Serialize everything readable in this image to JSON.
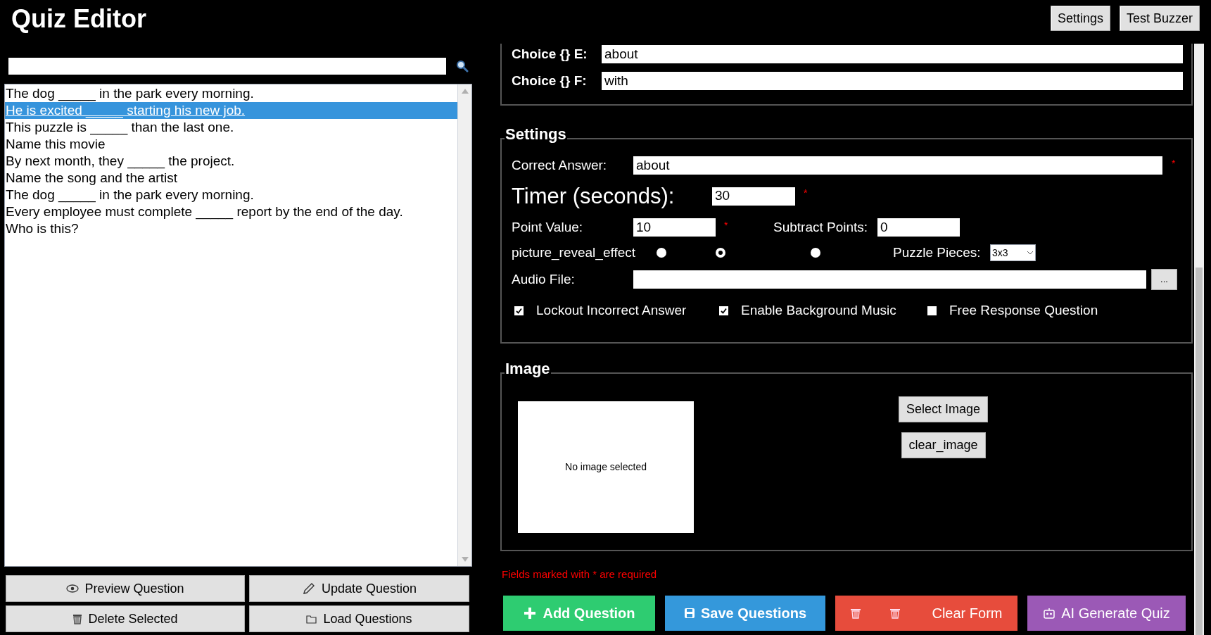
{
  "window": {
    "title": "Quiz Editor"
  },
  "header_buttons": [
    "Settings",
    "Test Buzzer"
  ],
  "questions": [
    {
      "text": "The dog _____ in the park every morning.",
      "selected": false
    },
    {
      "text": "He is excited _____ starting his new job.",
      "selected": true
    },
    {
      "text": "This puzzle is _____ than the last one.",
      "selected": false
    },
    {
      "text": "Name this movie",
      "selected": false
    },
    {
      "text": "By next month, they _____ the project.",
      "selected": false
    },
    {
      "text": "Name the song and the artist",
      "selected": false
    },
    {
      "text": "The dog _____ in the park every morning.",
      "selected": false
    },
    {
      "text": "Every employee must complete _____ report by the end of the day.",
      "selected": false
    },
    {
      "text": "Who is this?",
      "selected": false
    }
  ],
  "list_buttons": [
    "Preview Question",
    "Update Question",
    "Delete Selected",
    "Load Questions"
  ],
  "choices": [
    {
      "label": "Choice {} E:",
      "value": "about"
    },
    {
      "label": "Choice {} F:",
      "value": "with"
    }
  ],
  "settings": {
    "title": "Settings",
    "correct_answer": {
      "label": "Correct Answer:",
      "value": "about",
      "required_mark": "*"
    },
    "timer": {
      "label": "Timer (seconds):",
      "value": "30",
      "required_mark": "*"
    },
    "point_value": {
      "label": "Point Value:",
      "value": "10",
      "required_mark": "*"
    },
    "subtract_points": {
      "label": "Subtract Points:",
      "value": "0"
    },
    "reveal": {
      "label": "picture_reveal_effect",
      "options": [
        {
          "selected": false
        },
        {
          "selected": true
        },
        {
          "selected": false
        }
      ]
    },
    "puzzle_pieces": {
      "label": "Puzzle Pieces:",
      "value": "3x3"
    },
    "audio_file": {
      "label": "Audio File:",
      "browse": "..."
    },
    "checkboxes": [
      {
        "label": "Lockout Incorrect Answer",
        "checked": true
      },
      {
        "label": "Enable Background Music",
        "checked": true
      },
      {
        "label": "Free Response Question",
        "checked": false
      }
    ]
  },
  "image": {
    "title": "Image",
    "placeholder_text": "No image selected",
    "buttons": [
      "Select Image",
      "clear_image"
    ]
  },
  "required_note": "Fields marked with * are required",
  "actions": [
    {
      "label": "Add Question",
      "color": "#2ecc71"
    },
    {
      "label": "Save Questions",
      "color": "#3498db"
    },
    {
      "label": "Clear Form",
      "color": "#e74c3c"
    },
    {
      "label": "AI Generate Quiz",
      "color": "#9b59b6"
    }
  ]
}
